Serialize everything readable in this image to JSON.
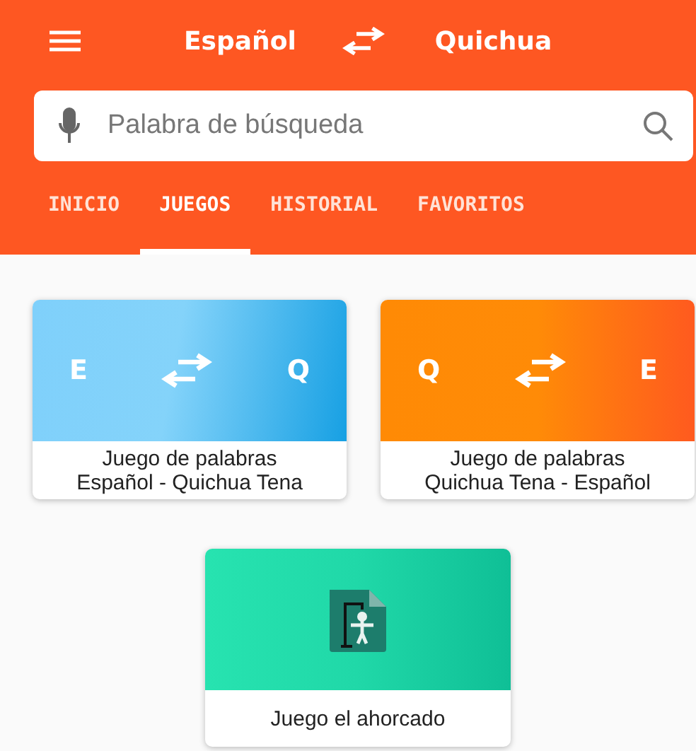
{
  "header": {
    "source_language": "Español",
    "target_language": "Quichua"
  },
  "search": {
    "placeholder": "Palabra de búsqueda"
  },
  "tabs": [
    {
      "label": "INICIO",
      "selected": false
    },
    {
      "label": "JUEGOS",
      "selected": true
    },
    {
      "label": "HISTORIAL",
      "selected": false
    },
    {
      "label": "FAVORITOS",
      "selected": false
    }
  ],
  "games": [
    {
      "kind": "forward",
      "from": "E",
      "to": "Q",
      "lines": [
        "Juego de palabras",
        "Español - Quichua Tena"
      ]
    },
    {
      "kind": "reverse",
      "from": "Q",
      "to": "E",
      "lines": [
        "Juego de palabras",
        "Quichua Tena - Español"
      ]
    },
    {
      "kind": "hangman",
      "lines": [
        "Juego el ahorcado"
      ]
    }
  ]
}
